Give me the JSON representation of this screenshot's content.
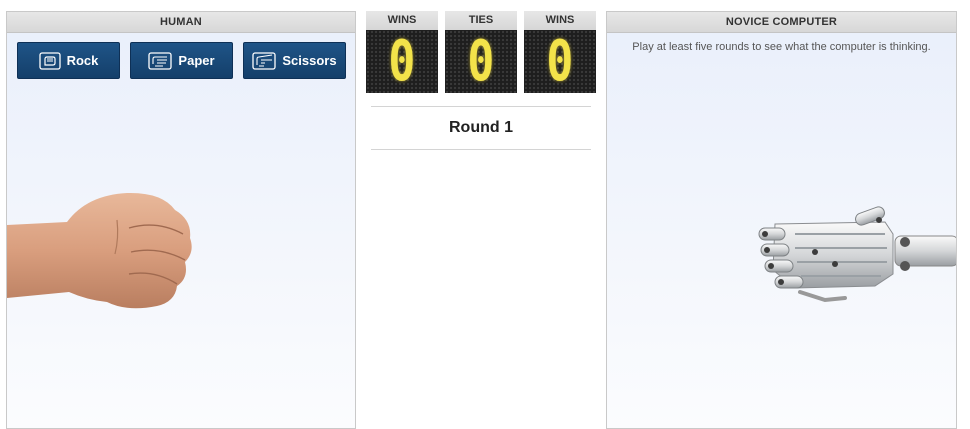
{
  "human": {
    "title": "HUMAN",
    "buttons": [
      {
        "label": "Rock",
        "icon": "rock-hand-icon"
      },
      {
        "label": "Paper",
        "icon": "paper-hand-icon"
      },
      {
        "label": "Scissors",
        "icon": "scissors-hand-icon"
      }
    ],
    "current_hand": "fist"
  },
  "scoreboard": {
    "wins_label": "WINS",
    "wins": "0",
    "ties_label": "TIES",
    "ties": "0",
    "computer_wins_label": "WINS",
    "computer_wins": "0",
    "round": "Round 1"
  },
  "computer": {
    "title": "NOVICE COMPUTER",
    "hint": "Play at least five rounds to see what the computer is thinking.",
    "current_hand": "robot-fist"
  },
  "colors": {
    "button_bg": "#1a4a7a",
    "digit": "#f3e34a",
    "panel_bg": "#eef2fb"
  }
}
